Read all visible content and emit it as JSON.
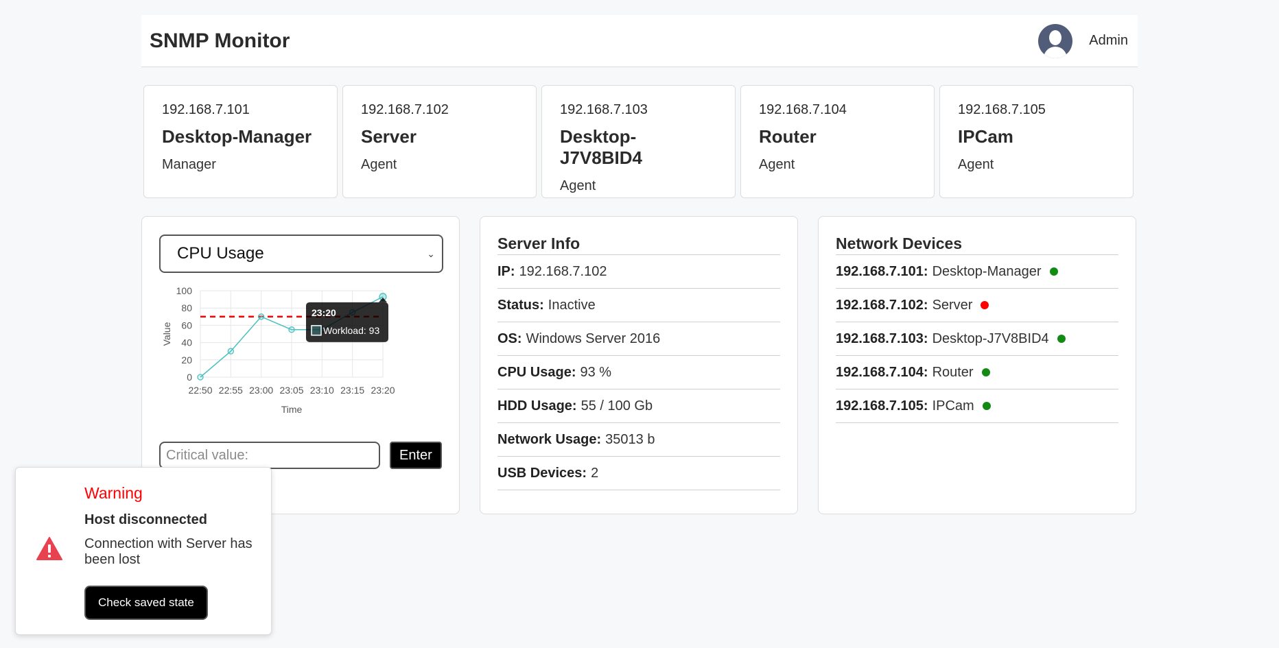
{
  "header": {
    "title": "SNMP Monitor",
    "user": "Admin"
  },
  "hosts": [
    {
      "ip": "192.168.7.101",
      "name": "Desktop-Manager",
      "role": "Manager"
    },
    {
      "ip": "192.168.7.102",
      "name": "Server",
      "role": "Agent"
    },
    {
      "ip": "192.168.7.103",
      "name": "Desktop-J7V8BID4",
      "role": "Agent"
    },
    {
      "ip": "192.168.7.104",
      "name": "Router",
      "role": "Agent"
    },
    {
      "ip": "192.168.7.105",
      "name": "IPCam",
      "role": "Agent"
    }
  ],
  "metric_panel": {
    "selected_metric": "CPU Usage",
    "critical_placeholder": "Critical value:",
    "enter_label": "Enter"
  },
  "chart_data": {
    "type": "line",
    "title": "",
    "xlabel": "Time",
    "ylabel": "Value",
    "categories": [
      "22:50",
      "22:55",
      "23:00",
      "23:05",
      "23:10",
      "23:15",
      "23:20"
    ],
    "series": [
      {
        "name": "Workload",
        "values": [
          0,
          30,
          70,
          55,
          55,
          75,
          93
        ]
      }
    ],
    "threshold": 70,
    "ylim": [
      0,
      100
    ],
    "yticks": [
      0,
      20,
      40,
      60,
      80,
      100
    ],
    "grid": true,
    "tooltip": {
      "title": "23:20",
      "label": "Workload: 93"
    },
    "colors": {
      "line": "#4bc0c0",
      "threshold": "#ff0000",
      "grid": "#e6e6e6"
    }
  },
  "server_info": {
    "title": "Server Info",
    "rows": [
      {
        "key": "IP:",
        "value": "192.168.7.102"
      },
      {
        "key": "Status:",
        "value": "Inactive"
      },
      {
        "key": "OS:",
        "value": "Windows Server 2016"
      },
      {
        "key": "CPU Usage:",
        "value": "93 %"
      },
      {
        "key": "HDD Usage:",
        "value": "55 / 100 Gb"
      },
      {
        "key": "Network Usage:",
        "value": "35013 b"
      },
      {
        "key": "USB Devices:",
        "value": "2"
      }
    ]
  },
  "network_devices": {
    "title": "Network Devices",
    "items": [
      {
        "ip": "192.168.7.101:",
        "name": "Desktop-Manager",
        "status_color": "#138a13"
      },
      {
        "ip": "192.168.7.102:",
        "name": "Server",
        "status_color": "#ff0000"
      },
      {
        "ip": "192.168.7.103:",
        "name": "Desktop-J7V8BID4",
        "status_color": "#138a13"
      },
      {
        "ip": "192.168.7.104:",
        "name": "Router",
        "status_color": "#138a13"
      },
      {
        "ip": "192.168.7.105:",
        "name": "IPCam",
        "status_color": "#138a13"
      }
    ]
  },
  "toast": {
    "title": "Warning",
    "subtitle": "Host disconnected",
    "message": "Connection with Server has been lost",
    "button": "Check saved state",
    "icon": "warning-triangle-icon"
  }
}
